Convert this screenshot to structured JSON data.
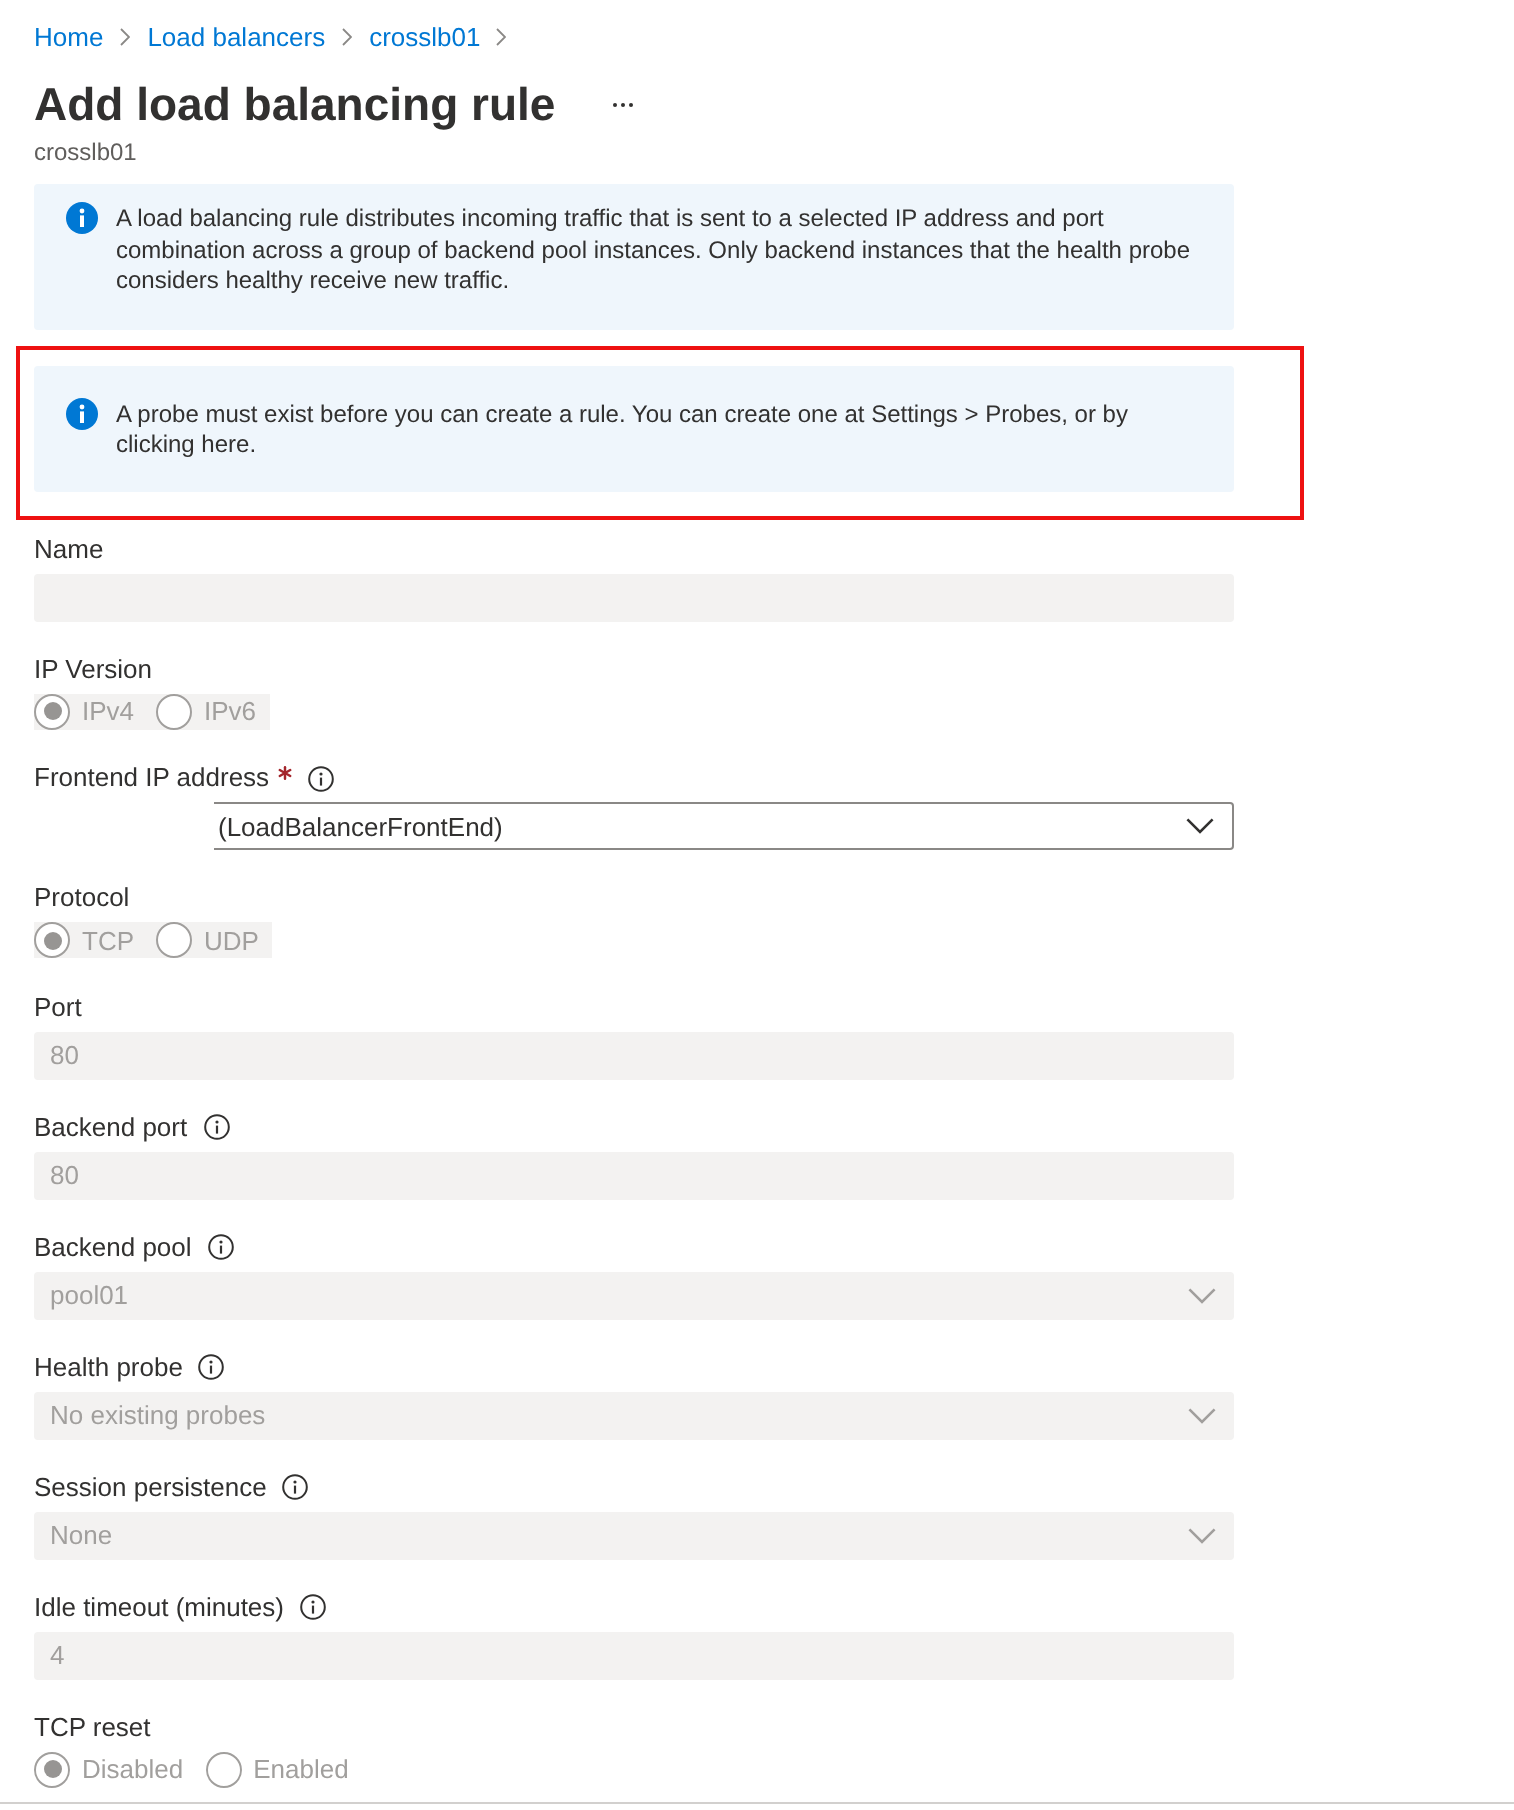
{
  "breadcrumb": [
    "Home",
    "Load balancers",
    "crosslb01"
  ],
  "header": {
    "title": "Add load balancing rule",
    "subtitle": "crosslb01"
  },
  "notices": [
    {
      "text": "A load balancing rule distributes incoming traffic that is sent to a selected IP address and port combination across a group of backend pool instances. Only backend instances that the health probe considers healthy receive new traffic.",
      "highlighted": false
    },
    {
      "text": "A probe must exist before you can create a rule. You can create one at Settings > Probes, or by clicking here.",
      "highlighted": true
    }
  ],
  "fields": [
    {
      "kind": "text",
      "label": "Name",
      "required": false,
      "info": false,
      "disabled": true
    },
    {
      "kind": "segmented",
      "label": "IP Version",
      "required": false,
      "info": false,
      "disabled": true,
      "options": [
        {
          "label": "IPv4",
          "selected": true
        },
        {
          "label": "IPv6",
          "selected": false
        }
      ]
    },
    {
      "kind": "dropdown",
      "label": "Frontend IP address",
      "required": true,
      "info": true,
      "disabled": false,
      "indented": true,
      "value": "(LoadBalancerFrontEnd)"
    },
    {
      "kind": "segmented",
      "label": "Protocol",
      "required": false,
      "info": false,
      "disabled": true,
      "options": [
        {
          "label": "TCP",
          "selected": true
        },
        {
          "label": "UDP",
          "selected": false
        }
      ]
    },
    {
      "kind": "text",
      "label": "Port",
      "required": false,
      "info": false,
      "disabled": true,
      "value": "80"
    },
    {
      "kind": "text",
      "label": "Backend port",
      "required": false,
      "info": true,
      "disabled": true,
      "value": "80"
    },
    {
      "kind": "dropdown",
      "label": "Backend pool",
      "required": false,
      "info": true,
      "disabled": true,
      "value": "pool01"
    },
    {
      "kind": "dropdown",
      "label": "Health probe",
      "required": false,
      "info": true,
      "disabled": true,
      "value": "No existing probes"
    },
    {
      "kind": "dropdown",
      "label": "Session persistence",
      "required": false,
      "info": true,
      "disabled": true,
      "value": "None"
    },
    {
      "kind": "text",
      "label": "Idle timeout (minutes)",
      "required": false,
      "info": true,
      "disabled": true,
      "value": "4"
    },
    {
      "kind": "radio",
      "label": "TCP reset",
      "required": false,
      "info": false,
      "disabled": true,
      "options": [
        {
          "label": "Disabled",
          "selected": true
        },
        {
          "label": "Enabled",
          "selected": false
        }
      ]
    }
  ]
}
